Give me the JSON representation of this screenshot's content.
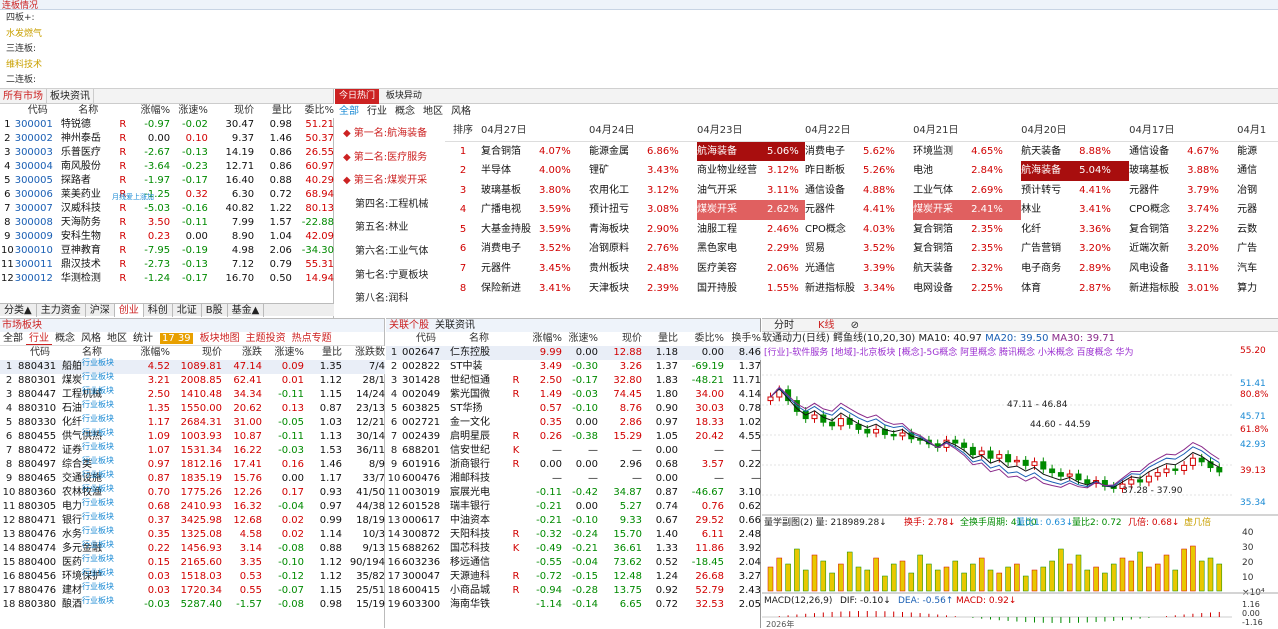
{
  "top_title": "连板情况",
  "lianban": {
    "rows": [
      {
        "label": "四板+:",
        "stock": ""
      },
      {
        "label": "",
        "stock": "水发燃气"
      },
      {
        "label": "三连板:",
        "stock": ""
      },
      {
        "label": "",
        "stock": "维科技术"
      },
      {
        "label": "二连板:",
        "stock": ""
      }
    ]
  },
  "market": {
    "tabs": [
      "所有市场",
      "板块资讯"
    ],
    "headers": [
      "代码",
      "名称",
      "涨幅%",
      "涨速%",
      "现价",
      "量比",
      "委比%"
    ],
    "rows": [
      [
        "1",
        "300001",
        "特锐德",
        "R",
        "-0.97",
        "-0.02",
        "30.47",
        "0.98",
        "51.21"
      ],
      [
        "2",
        "300002",
        "神州泰岳",
        "R",
        "0.00",
        "0.10",
        "9.37",
        "1.46",
        "50.37"
      ],
      [
        "3",
        "300003",
        "乐普医疗",
        "R",
        "-2.67",
        "-0.13",
        "14.19",
        "0.86",
        "26.55"
      ],
      [
        "4",
        "300004",
        "南风股份",
        "R",
        "-3.64",
        "-0.23",
        "12.71",
        "0.86",
        "60.97"
      ],
      [
        "5",
        "300005",
        "探路者",
        "R",
        "-1.97",
        "-0.17",
        "16.40",
        "0.88",
        "40.29"
      ],
      [
        "6",
        "300006",
        "莱美药业",
        "R",
        "-1.25",
        "0.32",
        "6.30",
        "0.72",
        "68.94"
      ],
      [
        "7",
        "300007",
        "汉威科技",
        "R",
        "-5.03",
        "-0.16",
        "40.82",
        "1.22",
        "80.13"
      ],
      [
        "8",
        "300008",
        "天海防务",
        "R",
        "3.50",
        "-0.11",
        "7.99",
        "1.57",
        "-22.88"
      ],
      [
        "9",
        "300009",
        "安科生物",
        "R",
        "0.23",
        "0.00",
        "8.90",
        "1.04",
        "42.09"
      ],
      [
        "10",
        "300010",
        "豆神教育",
        "R",
        "-7.95",
        "-0.19",
        "4.98",
        "2.06",
        "-34.30"
      ],
      [
        "11",
        "300011",
        "鼎汉技术",
        "R",
        "-2.73",
        "-0.13",
        "7.12",
        "0.79",
        "55.31"
      ],
      [
        "12",
        "300012",
        "华测检测",
        "R",
        "-1.24",
        "-0.17",
        "16.70",
        "0.50",
        "14.94"
      ]
    ],
    "tag": "月线爱上涨加",
    "bottom_tabs": [
      "分类▲",
      "主力资金",
      "沪深",
      "创业",
      "科创",
      "北证",
      "B股",
      "基金▲"
    ]
  },
  "hot": {
    "tab1": "今日热门",
    "tab2": "板块异动",
    "filters": [
      "全部",
      "行业",
      "概念",
      "地区",
      "风格"
    ],
    "ranks": [
      "第一名:航海装备",
      "第二名:医疗服务",
      "第三名:煤炭开采",
      "第四名:工程机械",
      "第五名:林业",
      "第六名:工业气体",
      "第七名:宁夏板块",
      "第八名:润科"
    ],
    "dates": [
      "排序",
      "04月27日",
      "04月24日",
      "04月23日",
      "04月22日",
      "04月21日",
      "04月20日",
      "04月17日",
      "04月1"
    ],
    "rows": [
      [
        "1",
        "复合铜箔",
        "4.07%",
        "能源金属",
        "6.86%",
        "航海装备",
        "5.06%",
        "消费电子",
        "5.62%",
        "环境监测",
        "4.65%",
        "航天装备",
        "8.88%",
        "通信设备",
        "4.67%",
        "能源"
      ],
      [
        "2",
        "半导体",
        "4.00%",
        "锂矿",
        "3.43%",
        "商业物业经营",
        "3.12%",
        "昨日断板",
        "5.26%",
        "电池",
        "2.84%",
        "航海装备",
        "5.04%",
        "玻璃基板",
        "3.88%",
        "通信"
      ],
      [
        "3",
        "玻璃基板",
        "3.80%",
        "农用化工",
        "3.12%",
        "油气开采",
        "3.11%",
        "通信设备",
        "4.88%",
        "工业气体",
        "2.69%",
        "预计转亏",
        "4.41%",
        "元器件",
        "3.79%",
        "冶钢"
      ],
      [
        "4",
        "广播电视",
        "3.59%",
        "预计扭亏",
        "3.08%",
        "煤炭开采",
        "2.62%",
        "元器件",
        "4.41%",
        "煤炭开采",
        "2.41%",
        "林业",
        "3.41%",
        "CPO概念",
        "3.74%",
        "元器"
      ],
      [
        "5",
        "大基金持股",
        "3.59%",
        "青海板块",
        "2.90%",
        "油服工程",
        "2.46%",
        "CPO概念",
        "4.03%",
        "复合铜箔",
        "2.35%",
        "化纤",
        "3.36%",
        "复合铜箔",
        "3.22%",
        "云数"
      ],
      [
        "6",
        "消费电子",
        "3.52%",
        "冶钢原料",
        "2.76%",
        "黑色家电",
        "2.29%",
        "贸易",
        "3.52%",
        "复合铜箔",
        "2.35%",
        "广告营销",
        "3.20%",
        "近端次新",
        "3.20%",
        "广告"
      ],
      [
        "7",
        "元器件",
        "3.45%",
        "贵州板块",
        "2.48%",
        "医疗美容",
        "2.06%",
        "光通信",
        "3.39%",
        "航天装备",
        "2.32%",
        "电子商务",
        "2.89%",
        "风电设备",
        "3.11%",
        "汽车"
      ],
      [
        "8",
        "保险新进",
        "3.41%",
        "天津板块",
        "2.39%",
        "国开持股",
        "1.55%",
        "新进指标股",
        "3.34%",
        "电网设备",
        "2.25%",
        "体育",
        "2.87%",
        "新进指标股",
        "3.01%",
        "算力"
      ]
    ]
  },
  "sector": {
    "tabs": [
      "全部",
      "行业",
      "概念",
      "风格",
      "地区",
      "统计"
    ],
    "badge": "17 39",
    "links": [
      "板块地图",
      "主题投资",
      "热点专题"
    ],
    "headers": [
      "代码",
      "名称",
      "涨幅%",
      "现价",
      "涨跌",
      "涨速%",
      "量比",
      "涨跌数"
    ],
    "tag": "行业板块",
    "rows": [
      [
        "1",
        "880431",
        "船舶",
        "4.52",
        "1089.81",
        "47.14",
        "0.09",
        "1.35",
        "7/4"
      ],
      [
        "2",
        "880301",
        "煤炭",
        "3.21",
        "2008.85",
        "62.41",
        "0.01",
        "1.12",
        "28/1"
      ],
      [
        "3",
        "880447",
        "工程机械",
        "2.50",
        "1410.48",
        "34.34",
        "-0.11",
        "1.15",
        "14/24"
      ],
      [
        "4",
        "880310",
        "石油",
        "1.35",
        "1550.00",
        "20.62",
        "0.13",
        "0.87",
        "23/13"
      ],
      [
        "5",
        "880330",
        "化纤",
        "1.17",
        "2684.31",
        "31.00",
        "-0.05",
        "1.03",
        "12/21"
      ],
      [
        "6",
        "880455",
        "供气供热",
        "1.09",
        "1003.93",
        "10.87",
        "-0.11",
        "1.13",
        "30/14"
      ],
      [
        "7",
        "880472",
        "证券",
        "1.07",
        "1531.34",
        "16.22",
        "-0.03",
        "1.53",
        "36/11"
      ],
      [
        "8",
        "880497",
        "综合类",
        "0.97",
        "1812.16",
        "17.41",
        "0.16",
        "1.46",
        "8/9"
      ],
      [
        "9",
        "880465",
        "交通设施",
        "0.87",
        "1835.19",
        "15.76",
        "0.00",
        "1.17",
        "33/7"
      ],
      [
        "10",
        "880360",
        "农林牧渔",
        "0.70",
        "1775.26",
        "12.26",
        "0.17",
        "0.93",
        "41/50"
      ],
      [
        "11",
        "880305",
        "电力",
        "0.68",
        "2410.93",
        "16.32",
        "-0.04",
        "0.97",
        "44/38"
      ],
      [
        "12",
        "880471",
        "银行",
        "0.37",
        "3425.98",
        "12.68",
        "0.02",
        "0.99",
        "18/19"
      ],
      [
        "13",
        "880476",
        "水务",
        "0.35",
        "1325.08",
        "4.58",
        "0.02",
        "1.14",
        "10/3"
      ],
      [
        "14",
        "880474",
        "多元金融",
        "0.22",
        "1456.93",
        "3.14",
        "-0.08",
        "0.88",
        "9/13"
      ],
      [
        "15",
        "880400",
        "医药",
        "0.15",
        "2165.60",
        "3.35",
        "-0.10",
        "1.12",
        "90/194"
      ],
      [
        "16",
        "880456",
        "环境保护",
        "0.03",
        "1518.03",
        "0.53",
        "-0.12",
        "1.12",
        "35/82"
      ],
      [
        "17",
        "880476",
        "建材",
        "0.03",
        "1720.34",
        "0.55",
        "-0.07",
        "1.15",
        "25/51"
      ],
      [
        "18",
        "880380",
        "酿酒",
        "-0.03",
        "5287.40",
        "-1.57",
        "-0.08",
        "0.98",
        "15/19"
      ]
    ]
  },
  "related": {
    "tabs": [
      "关联个股",
      "关联资讯"
    ],
    "headers": [
      "代码",
      "名称",
      "涨幅%",
      "涨速%",
      "现价",
      "量比",
      "委比%",
      "换手%"
    ],
    "rows": [
      [
        "1",
        "002647",
        "仁东控股",
        "",
        "9.99",
        "0.00",
        "12.88",
        "1.18",
        "0.00",
        "8.46"
      ],
      [
        "2",
        "002822",
        "ST中装",
        "",
        "3.49",
        "-0.30",
        "3.26",
        "1.37",
        "-69.19",
        "1.37"
      ],
      [
        "3",
        "301428",
        "世纪恒通",
        "R",
        "2.50",
        "-0.17",
        "32.80",
        "1.83",
        "-48.21",
        "11.71"
      ],
      [
        "4",
        "002049",
        "紫光国微",
        "R",
        "1.49",
        "-0.03",
        "74.45",
        "1.80",
        "34.00",
        "4.14"
      ],
      [
        "5",
        "603825",
        "ST华扬",
        "",
        "0.57",
        "-0.10",
        "8.76",
        "0.90",
        "30.03",
        "0.78"
      ],
      [
        "6",
        "002721",
        "金一文化",
        "",
        "0.35",
        "0.00",
        "2.86",
        "0.97",
        "18.33",
        "1.02"
      ],
      [
        "7",
        "002439",
        "启明星辰",
        "R",
        "0.26",
        "-0.38",
        "15.29",
        "1.05",
        "20.42",
        "4.55"
      ],
      [
        "8",
        "688201",
        "信安世纪",
        "K",
        "—",
        "—",
        "—",
        "0.00",
        "—",
        "—"
      ],
      [
        "9",
        "601916",
        "浙商银行",
        "R",
        "0.00",
        "0.00",
        "2.96",
        "0.68",
        "3.57",
        "0.22"
      ],
      [
        "10",
        "600476",
        "湘邮科技",
        "",
        "—",
        "—",
        "—",
        "0.00",
        "—",
        "—"
      ],
      [
        "11",
        "003019",
        "宸展光电",
        "",
        "-0.11",
        "-0.42",
        "34.87",
        "0.87",
        "-46.67",
        "3.10"
      ],
      [
        "12",
        "601528",
        "瑞丰银行",
        "",
        "-0.21",
        "0.00",
        "5.27",
        "0.74",
        "0.76",
        "0.62"
      ],
      [
        "13",
        "000617",
        "中油资本",
        "",
        "-0.21",
        "-0.10",
        "9.33",
        "0.67",
        "29.52",
        "0.66"
      ],
      [
        "14",
        "300872",
        "天阳科技",
        "R",
        "-0.32",
        "-0.24",
        "15.70",
        "1.40",
        "6.11",
        "2.48"
      ],
      [
        "15",
        "688262",
        "国芯科技",
        "K",
        "-0.49",
        "-0.21",
        "36.61",
        "1.33",
        "11.86",
        "3.92"
      ],
      [
        "16",
        "603236",
        "移远通信",
        "",
        "-0.55",
        "-0.04",
        "73.62",
        "0.52",
        "-18.45",
        "2.04"
      ],
      [
        "17",
        "300047",
        "天源迪科",
        "R",
        "-0.72",
        "-0.15",
        "12.48",
        "1.24",
        "26.68",
        "3.27"
      ],
      [
        "18",
        "600415",
        "小商品城",
        "R",
        "-0.94",
        "-0.28",
        "13.75",
        "0.92",
        "52.79",
        "2.43"
      ],
      [
        "19",
        "603300",
        "海南华铁",
        "",
        "-1.14",
        "-0.14",
        "6.65",
        "0.72",
        "32.53",
        "2.05"
      ]
    ]
  },
  "kline": {
    "tabs": [
      "分时",
      "K线"
    ],
    "title": "软通动力(日线)",
    "ma_label": "鳄鱼线(10,20,30)",
    "ma10": "MA10: 40.97",
    "ma20": "MA20: 39.50",
    "ma30": "MA30: 39.71",
    "concepts": "[行业]-软件服务 [地域]-北京板块 [概念]-5G概念 阿里概念 腾讯概念 小米概念 百度概念 华为",
    "ann1": "47.11 - 46.84",
    "ann2": "44.60 - 44.59",
    "ann3": "37.28 - 37.90",
    "yticks": [
      "55.20",
      "51.41",
      "80.8%",
      "45.71",
      "61.8%",
      "42.93",
      "39.13",
      "35.34"
    ],
    "vol_title": "量学副图(2) 量: 218989.28↓",
    "vol_items": [
      "换手: 2.78↓",
      "全换手周期: 41.00",
      "量比1: 0.63↓",
      "量比2: 0.72",
      "几倍: 0.68↓",
      "虚几倍"
    ],
    "vol_ticks": [
      "40",
      "30",
      "20",
      "10",
      "×10⁴"
    ],
    "macd_title": "MACD(12,26,9)",
    "macd_dif": "DIF: -0.10↓",
    "macd_dea": "DEA: -0.56↑",
    "macd_val": "MACD: 0.92↓",
    "macd_ticks": [
      "1.16",
      "0.00",
      "-1.16"
    ],
    "date_label": "2026年"
  }
}
